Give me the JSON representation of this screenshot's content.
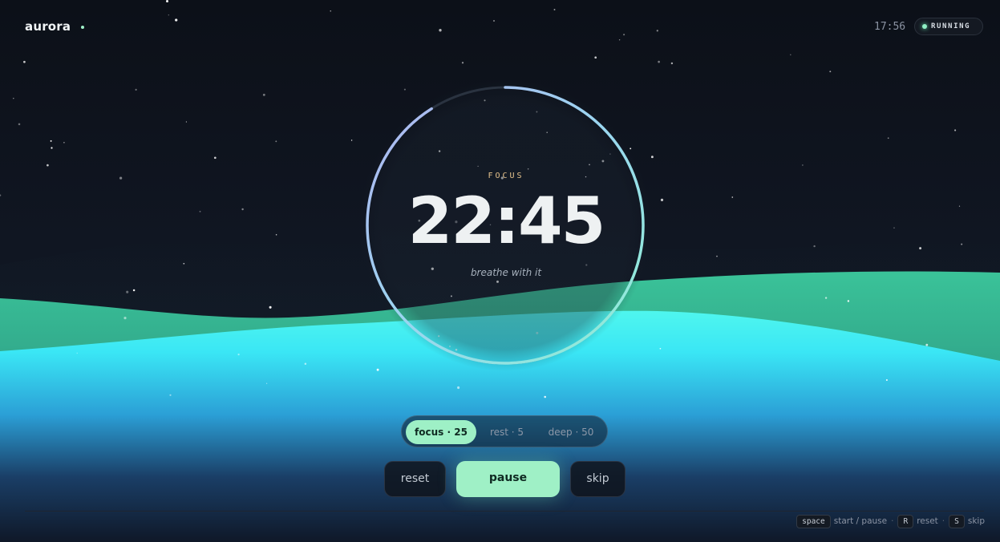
{
  "header": {
    "brand": "aurora",
    "clock": "17:56",
    "status": "RUNNING"
  },
  "timer": {
    "mode_label": "FOCUS",
    "time": "22:45",
    "tagline": "breathe with it",
    "progress_elapsed_fraction": 0.09
  },
  "presets": [
    {
      "label": "focus · 25",
      "active": true
    },
    {
      "label": "rest · 5",
      "active": false
    },
    {
      "label": "deep · 50",
      "active": false
    }
  ],
  "controls": {
    "reset": "reset",
    "pause": "pause",
    "skip": "skip"
  },
  "shortcuts": [
    {
      "key": "space",
      "action": "start / pause"
    },
    {
      "key": "R",
      "action": "reset"
    },
    {
      "key": "S",
      "action": "skip"
    }
  ],
  "colors": {
    "accent": "#9ff0c6",
    "mode_label": "#e7c48d",
    "ring_start": "#8ef0d2",
    "ring_end": "#b0b2f0",
    "wave_front": "#4ff5ee",
    "wave_back": "#3fd6a6"
  },
  "icons": {
    "status": "status-dot-icon",
    "brand": "brand-dot-icon"
  }
}
